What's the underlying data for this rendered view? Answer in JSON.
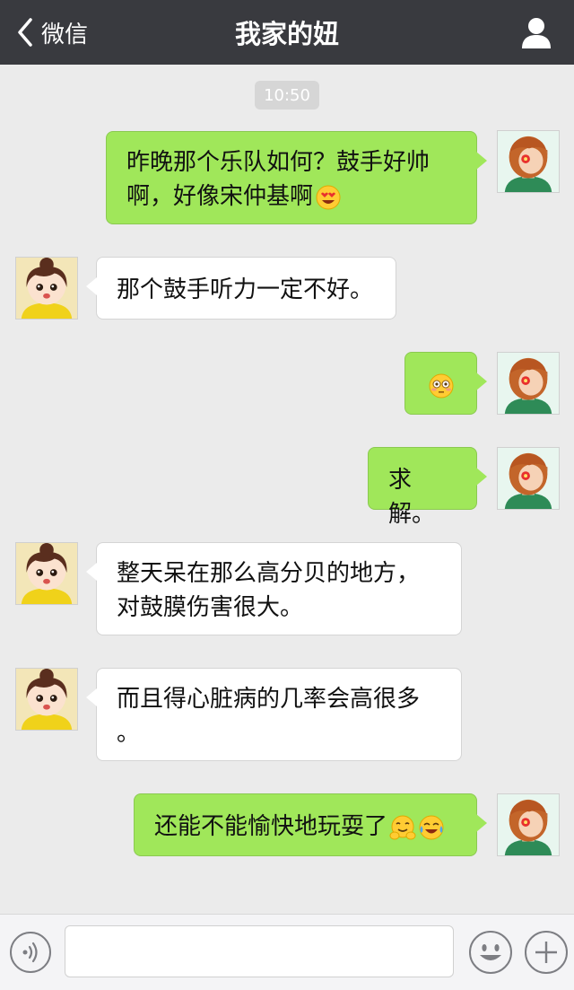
{
  "header": {
    "back_label": "微信",
    "title": "我家的妞"
  },
  "chat": {
    "timestamp": "10:50",
    "messages": [
      {
        "side": "out",
        "lines": [
          "昨晚那个乐队如何？鼓手好帅",
          "啊，好像宋仲基啊"
        ],
        "emoji": [
          "heart-eyes"
        ]
      },
      {
        "side": "in",
        "lines": [
          "那个鼓手听力一定不好。"
        ]
      },
      {
        "side": "out",
        "lines": [
          ""
        ],
        "emoji": [
          "flushed"
        ]
      },
      {
        "side": "out",
        "lines": [
          "求解。"
        ]
      },
      {
        "side": "in",
        "lines": [
          "整天呆在那么高分贝的地方，",
          "对鼓膜伤害很大。"
        ]
      },
      {
        "side": "in",
        "lines": [
          "而且得心脏病的几率会高很多",
          "。"
        ]
      },
      {
        "side": "out",
        "lines": [
          "还能不能愉快地玩耍了"
        ],
        "emoji": [
          "hugging",
          "tears-of-joy"
        ]
      }
    ]
  },
  "input": {
    "voice_icon": "voice-icon",
    "emoji_icon": "smiley-icon",
    "plus_icon": "plus-icon",
    "value": ""
  },
  "colors": {
    "header_bg": "#393a3f",
    "chat_bg": "#ebebeb",
    "outgoing_bubble": "#a0e75a",
    "incoming_bubble": "#ffffff"
  }
}
